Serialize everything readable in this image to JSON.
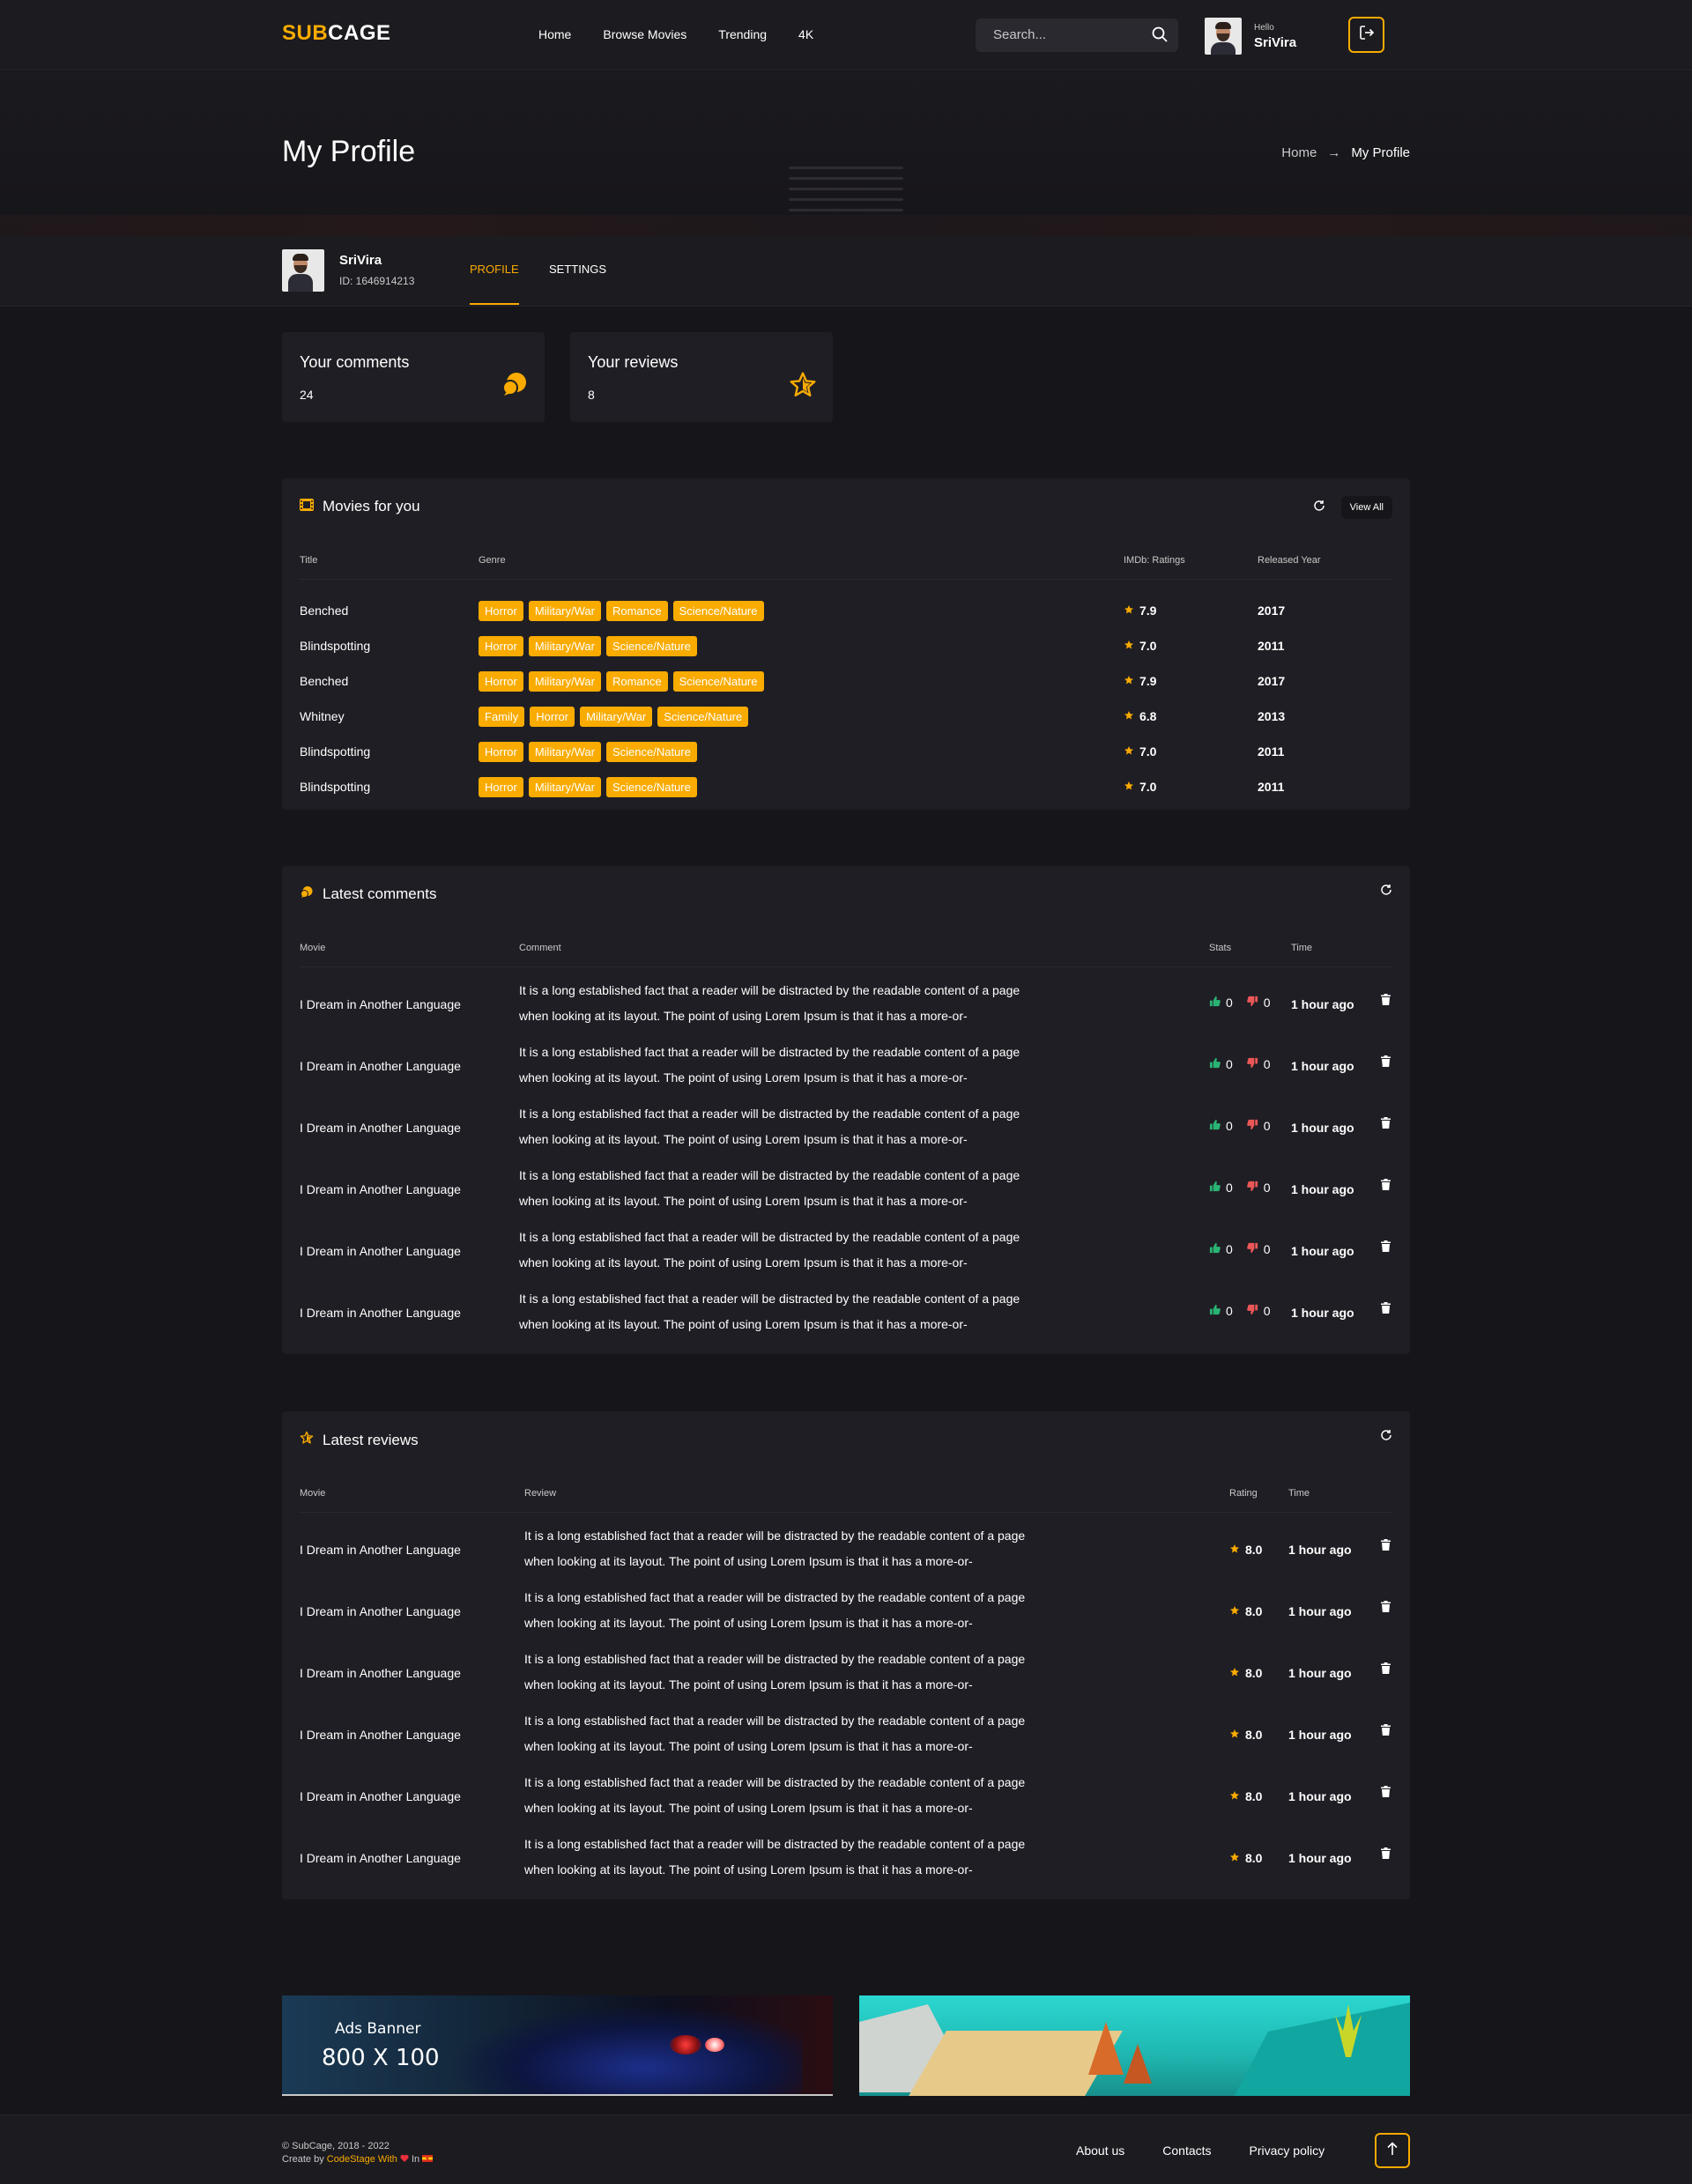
{
  "header": {
    "logo_part1": "SUB",
    "logo_part2": "CAGE",
    "nav": [
      "Home",
      "Browse Movies",
      "Trending",
      "4K"
    ],
    "search_placeholder": "Search...",
    "user_hello": "Hello",
    "user_name": "SriVira"
  },
  "page": {
    "title": "My Profile",
    "breadcrumb_home": "Home",
    "breadcrumb_arrow": "→",
    "breadcrumb_current": "My Profile"
  },
  "profile": {
    "name": "SriVira",
    "id": "ID: 1646914213",
    "tabs": [
      "PROFILE",
      "SETTINGS"
    ]
  },
  "stats": {
    "comments_title": "Your comments",
    "comments_value": "24",
    "reviews_title": "Your reviews",
    "reviews_value": "8"
  },
  "movies": {
    "title": "Movies for you",
    "view_all": "View All",
    "headers": [
      "Title",
      "Genre",
      "IMDb: Ratings",
      "Released Year"
    ],
    "rows": [
      {
        "title": "Benched",
        "genres": [
          "Horror",
          "Military/War",
          "Romance",
          "Science/Nature"
        ],
        "rating": "7.9",
        "year": "2017"
      },
      {
        "title": "Blindspotting",
        "genres": [
          "Horror",
          "Military/War",
          "Science/Nature"
        ],
        "rating": "7.0",
        "year": "2011"
      },
      {
        "title": "Benched",
        "genres": [
          "Horror",
          "Military/War",
          "Romance",
          "Science/Nature"
        ],
        "rating": "7.9",
        "year": "2017"
      },
      {
        "title": "Whitney",
        "genres": [
          "Family",
          "Horror",
          "Military/War",
          "Science/Nature"
        ],
        "rating": "6.8",
        "year": "2013"
      },
      {
        "title": "Blindspotting",
        "genres": [
          "Horror",
          "Military/War",
          "Science/Nature"
        ],
        "rating": "7.0",
        "year": "2011"
      },
      {
        "title": "Blindspotting",
        "genres": [
          "Horror",
          "Military/War",
          "Science/Nature"
        ],
        "rating": "7.0",
        "year": "2011"
      }
    ]
  },
  "comments": {
    "title": "Latest comments",
    "headers": [
      "Movie",
      "Comment",
      "Stats",
      "Time"
    ],
    "rows": [
      {
        "movie": "I Dream in Another Language",
        "line1": "It is a long established fact that a reader will be distracted by the readable content of a page",
        "line2": "when looking at its layout. The point of using Lorem Ipsum is that it has a more-or-",
        "likes": "0",
        "dislikes": "0",
        "time": "1 hour ago"
      },
      {
        "movie": "I Dream in Another Language",
        "line1": "It is a long established fact that a reader will be distracted by the readable content of a page",
        "line2": "when looking at its layout. The point of using Lorem Ipsum is that it has a more-or-",
        "likes": "0",
        "dislikes": "0",
        "time": "1 hour ago"
      },
      {
        "movie": "I Dream in Another Language",
        "line1": "It is a long established fact that a reader will be distracted by the readable content of a page",
        "line2": "when looking at its layout. The point of using Lorem Ipsum is that it has a more-or-",
        "likes": "0",
        "dislikes": "0",
        "time": "1 hour ago"
      },
      {
        "movie": "I Dream in Another Language",
        "line1": "It is a long established fact that a reader will be distracted by the readable content of a page",
        "line2": "when looking at its layout. The point of using Lorem Ipsum is that it has a more-or-",
        "likes": "0",
        "dislikes": "0",
        "time": "1 hour ago"
      },
      {
        "movie": "I Dream in Another Language",
        "line1": "It is a long established fact that a reader will be distracted by the readable content of a page",
        "line2": "when looking at its layout. The point of using Lorem Ipsum is that it has a more-or-",
        "likes": "0",
        "dislikes": "0",
        "time": "1 hour ago"
      },
      {
        "movie": "I Dream in Another Language",
        "line1": "It is a long established fact that a reader will be distracted by the readable content of a page",
        "line2": "when looking at its layout. The point of using Lorem Ipsum is that it has a more-or-",
        "likes": "0",
        "dislikes": "0",
        "time": "1 hour ago"
      }
    ]
  },
  "reviews": {
    "title": "Latest reviews",
    "headers": [
      "Movie",
      "Review",
      "Rating",
      "Time"
    ],
    "rows": [
      {
        "movie": "I Dream in Another Language",
        "line1": "It is a long established fact that a reader will be distracted by the readable content of a page",
        "line2": "when looking at its layout. The point of using Lorem Ipsum is that it has a more-or-",
        "rating": "8.0",
        "time": "1 hour ago"
      },
      {
        "movie": "I Dream in Another Language",
        "line1": "It is a long established fact that a reader will be distracted by the readable content of a page",
        "line2": "when looking at its layout. The point of using Lorem Ipsum is that it has a more-or-",
        "rating": "8.0",
        "time": "1 hour ago"
      },
      {
        "movie": "I Dream in Another Language",
        "line1": "It is a long established fact that a reader will be distracted by the readable content of a page",
        "line2": "when looking at its layout. The point of using Lorem Ipsum is that it has a more-or-",
        "rating": "8.0",
        "time": "1 hour ago"
      },
      {
        "movie": "I Dream in Another Language",
        "line1": "It is a long established fact that a reader will be distracted by the readable content of a page",
        "line2": "when looking at its layout. The point of using Lorem Ipsum is that it has a more-or-",
        "rating": "8.0",
        "time": "1 hour ago"
      },
      {
        "movie": "I Dream in Another Language",
        "line1": "It is a long established fact that a reader will be distracted by the readable content of a page",
        "line2": "when looking at its layout. The point of using Lorem Ipsum is that it has a more-or-",
        "rating": "8.0",
        "time": "1 hour ago"
      },
      {
        "movie": "I Dream in Another Language",
        "line1": "It is a long established fact that a reader will be distracted by the readable content of a page",
        "line2": "when looking at its layout. The point of using Lorem Ipsum is that it has a more-or-",
        "rating": "8.0",
        "time": "1 hour ago"
      }
    ]
  },
  "banners": {
    "left_label1": "Ads Banner",
    "left_label2": "800 X 100"
  },
  "footer": {
    "copyright": "© SubCage, 2018 - 2022",
    "created_prefix": "Create by",
    "created_brand": "CodeStage With",
    "created_suffix": "In",
    "links": [
      "About us",
      "Contacts",
      "Privacy policy"
    ]
  },
  "colors": {
    "accent": "#f9ab00",
    "background": "#16151a",
    "panel": "#1f1e24",
    "like": "#29b474",
    "dislike": "#eb5757"
  },
  "icons": [
    "search-icon",
    "logout-icon",
    "comments-icon",
    "star-outline-icon",
    "film-icon",
    "refresh-icon",
    "star-icon",
    "thumbs-up-icon",
    "thumbs-down-icon",
    "trash-icon",
    "heart-icon",
    "flag-icon",
    "arrow-up-icon"
  ]
}
